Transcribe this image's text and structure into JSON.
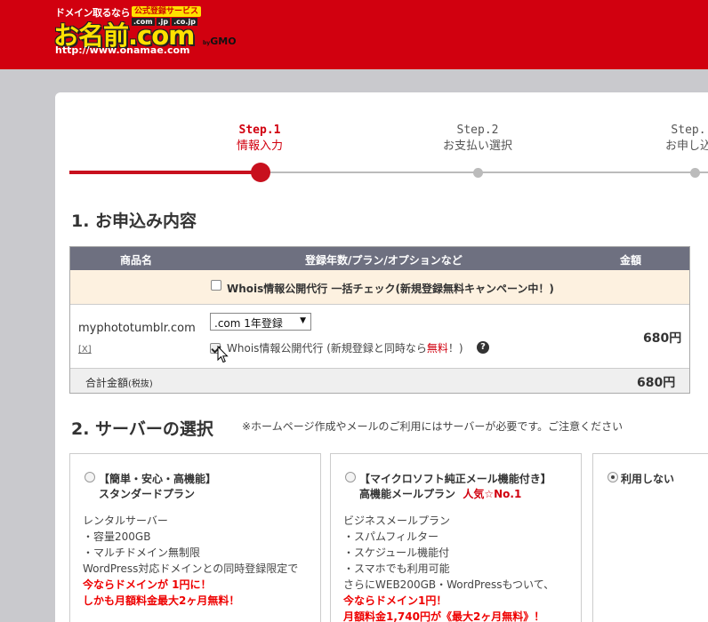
{
  "header": {
    "tagline": "ドメイン取るなら",
    "badge": "公式登録サービス",
    "tlds": [
      ".com",
      ".jp",
      ".co.jp"
    ],
    "brand": "お名前.com",
    "by_prefix": "by",
    "by_brand": "GMO",
    "url": "http://www.onamae.com"
  },
  "steps": [
    {
      "num": "Step.1",
      "label": "情報入力"
    },
    {
      "num": "Step.2",
      "label": "お支払い選択"
    },
    {
      "num": "Step.",
      "label": "お申し込"
    }
  ],
  "section1": {
    "title": "1. お申込み内容",
    "headers": [
      "商品名",
      "登録年数/プラン/オプションなど",
      "金額"
    ],
    "campaign_text": "Whois情報公開代行 一括チェック(新規登録無料キャンペーン中！)",
    "item": {
      "domain": "myphototumblr.com",
      "remove": "[X]",
      "plan": ".com 1年登録",
      "whois_label": "Whois情報公開代行 (新規登録と同時なら",
      "whois_free": "無料",
      "whois_end": "！)",
      "help": "?",
      "price": "680円"
    },
    "total_label": "合計金額",
    "total_tax": "(税抜)",
    "total_amount": "680円"
  },
  "section2": {
    "title": "2. サーバーの選択",
    "note": "※ホームページ作成やメールのご利用にはサーバーが必要です。ご注意ください",
    "cards": [
      {
        "title_line1": "【簡単・安心・高機能】",
        "title_line2": "スタンダードプラン",
        "title_badge": "",
        "lines": [
          "レンタルサーバー",
          "・容量200GB",
          "・マルチドメイン無制限",
          "WordPress対応ドメインとの同時登録限定で"
        ],
        "red_lines": [
          "今ならドメインが 1円に！",
          "しかも月額料金最大2ヶ月無料！"
        ]
      },
      {
        "title_line1": "【マイクロソフト純正メール機能付き】",
        "title_line2": "高機能メールプラン",
        "title_badge": "人気☆No.1",
        "lines": [
          "ビジネスメールプラン",
          "・スパムフィルター",
          "・スケジュール機能付",
          "・スマホでも利用可能",
          "さらにWEB200GB・WordPressもついて、"
        ],
        "red_lines": [
          "今ならドメイン1円！",
          "月額料金1,740円が《最大2ヶ月無料》！"
        ]
      },
      {
        "title_line1": "利用しない",
        "title_line2": "",
        "title_badge": "",
        "lines": [],
        "red_lines": []
      }
    ]
  },
  "colors": {
    "brand_red": "#d1000f",
    "header_gray": "#6e7080",
    "campaign_bg": "#fdf1e0"
  }
}
